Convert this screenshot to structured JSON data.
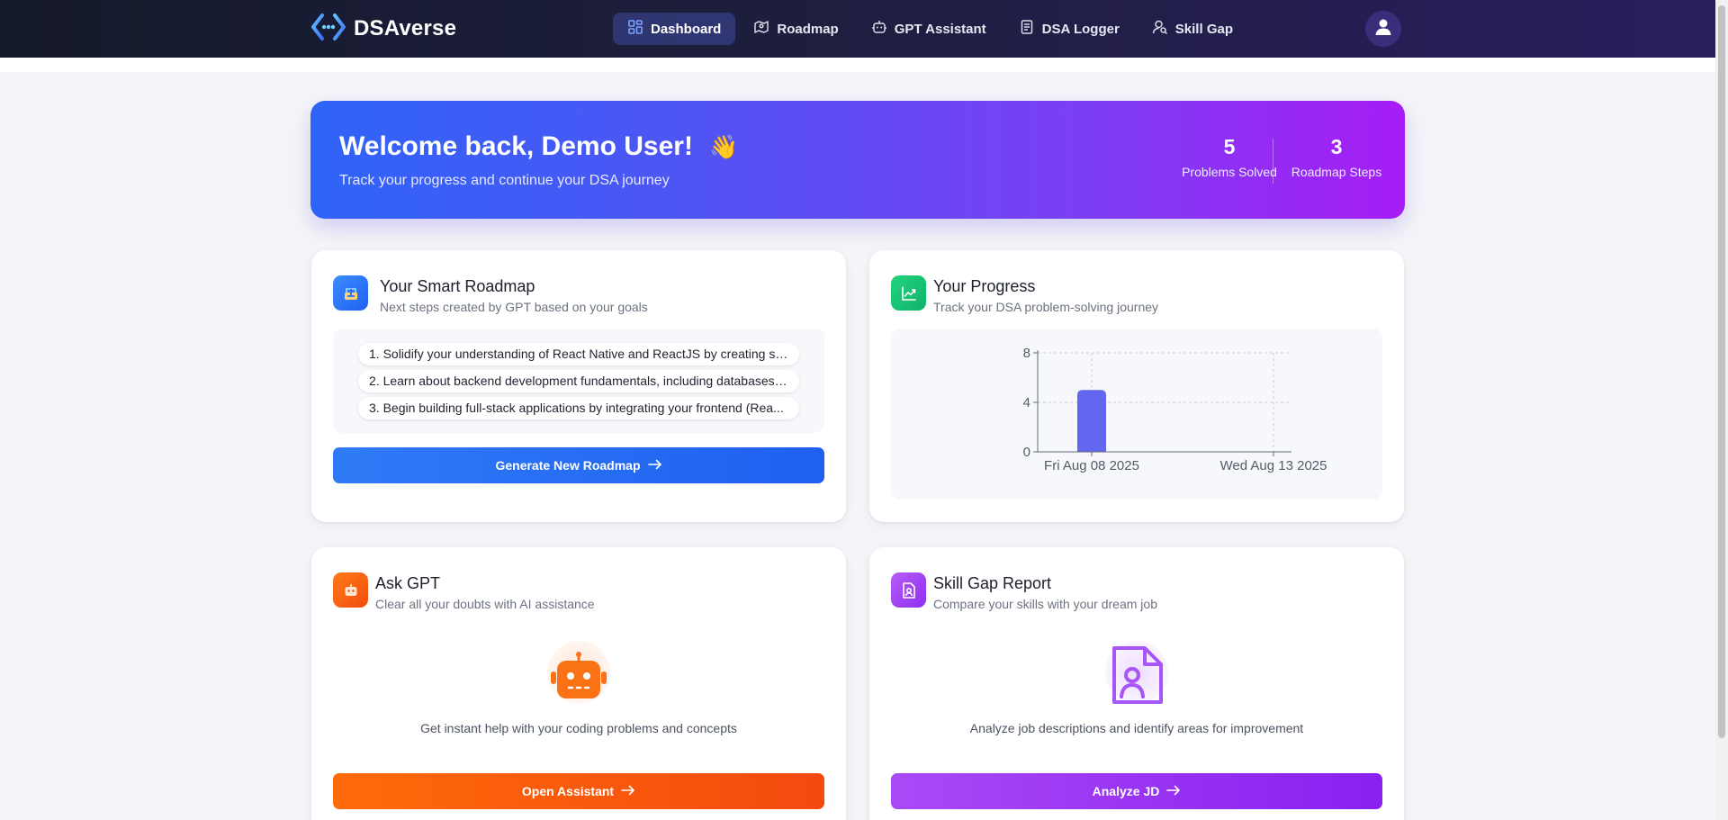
{
  "app": {
    "name": "DSAverse"
  },
  "nav": {
    "items": [
      {
        "label": "Dashboard",
        "icon": "dashboard-icon",
        "active": true
      },
      {
        "label": "Roadmap",
        "icon": "map-icon",
        "active": false
      },
      {
        "label": "GPT Assistant",
        "icon": "robot-icon",
        "active": false
      },
      {
        "label": "DSA Logger",
        "icon": "document-icon",
        "active": false
      },
      {
        "label": "Skill Gap",
        "icon": "user-search-icon",
        "active": false
      }
    ],
    "avatar_icon": "user-icon"
  },
  "welcome": {
    "title": "Welcome back, Demo User!",
    "emoji": "👋",
    "subtitle": "Track your progress and continue your DSA journey",
    "stats": [
      {
        "value": "5",
        "label": "Problems Solved"
      },
      {
        "value": "3",
        "label": "Roadmap Steps"
      }
    ]
  },
  "roadmap_card": {
    "title": "Your Smart Roadmap",
    "subtitle": "Next steps created by GPT based on your goals",
    "steps": [
      "1. Solidify your understanding of React Native and ReactJS by creating sm...",
      "2. Learn about backend development fundamentals, including databases, ...",
      "3. Begin building full-stack applications by integrating your frontend (Rea..."
    ],
    "button_label": "Generate New Roadmap",
    "icon": "roadmap-icon",
    "accent": "#2f7bf7"
  },
  "progress_card": {
    "title": "Your Progress",
    "subtitle": "Track your DSA problem-solving journey",
    "icon": "trend-chart-icon",
    "accent": "#16c784"
  },
  "chart_data": {
    "type": "bar",
    "categories": [
      "Fri Aug 08 2025",
      "Wed Aug 13 2025"
    ],
    "values": [
      5,
      0
    ],
    "ylim": [
      0,
      8
    ],
    "yticks": [
      "0",
      "4",
      "8"
    ],
    "grid": true,
    "bar_color": "#6366f1"
  },
  "gpt_card": {
    "title": "Ask GPT",
    "subtitle": "Clear all your doubts with AI assistance",
    "description": "Get instant help with your coding problems and concepts",
    "button_label": "Open Assistant",
    "icon": "robot-icon",
    "accent": "#ff6a0a"
  },
  "skill_card": {
    "title": "Skill Gap Report",
    "subtitle": "Compare your skills with your dream job",
    "description": "Analyze job descriptions and identify areas for improvement",
    "button_label": "Analyze JD",
    "icon": "user-document-icon",
    "accent": "#a94af6"
  }
}
